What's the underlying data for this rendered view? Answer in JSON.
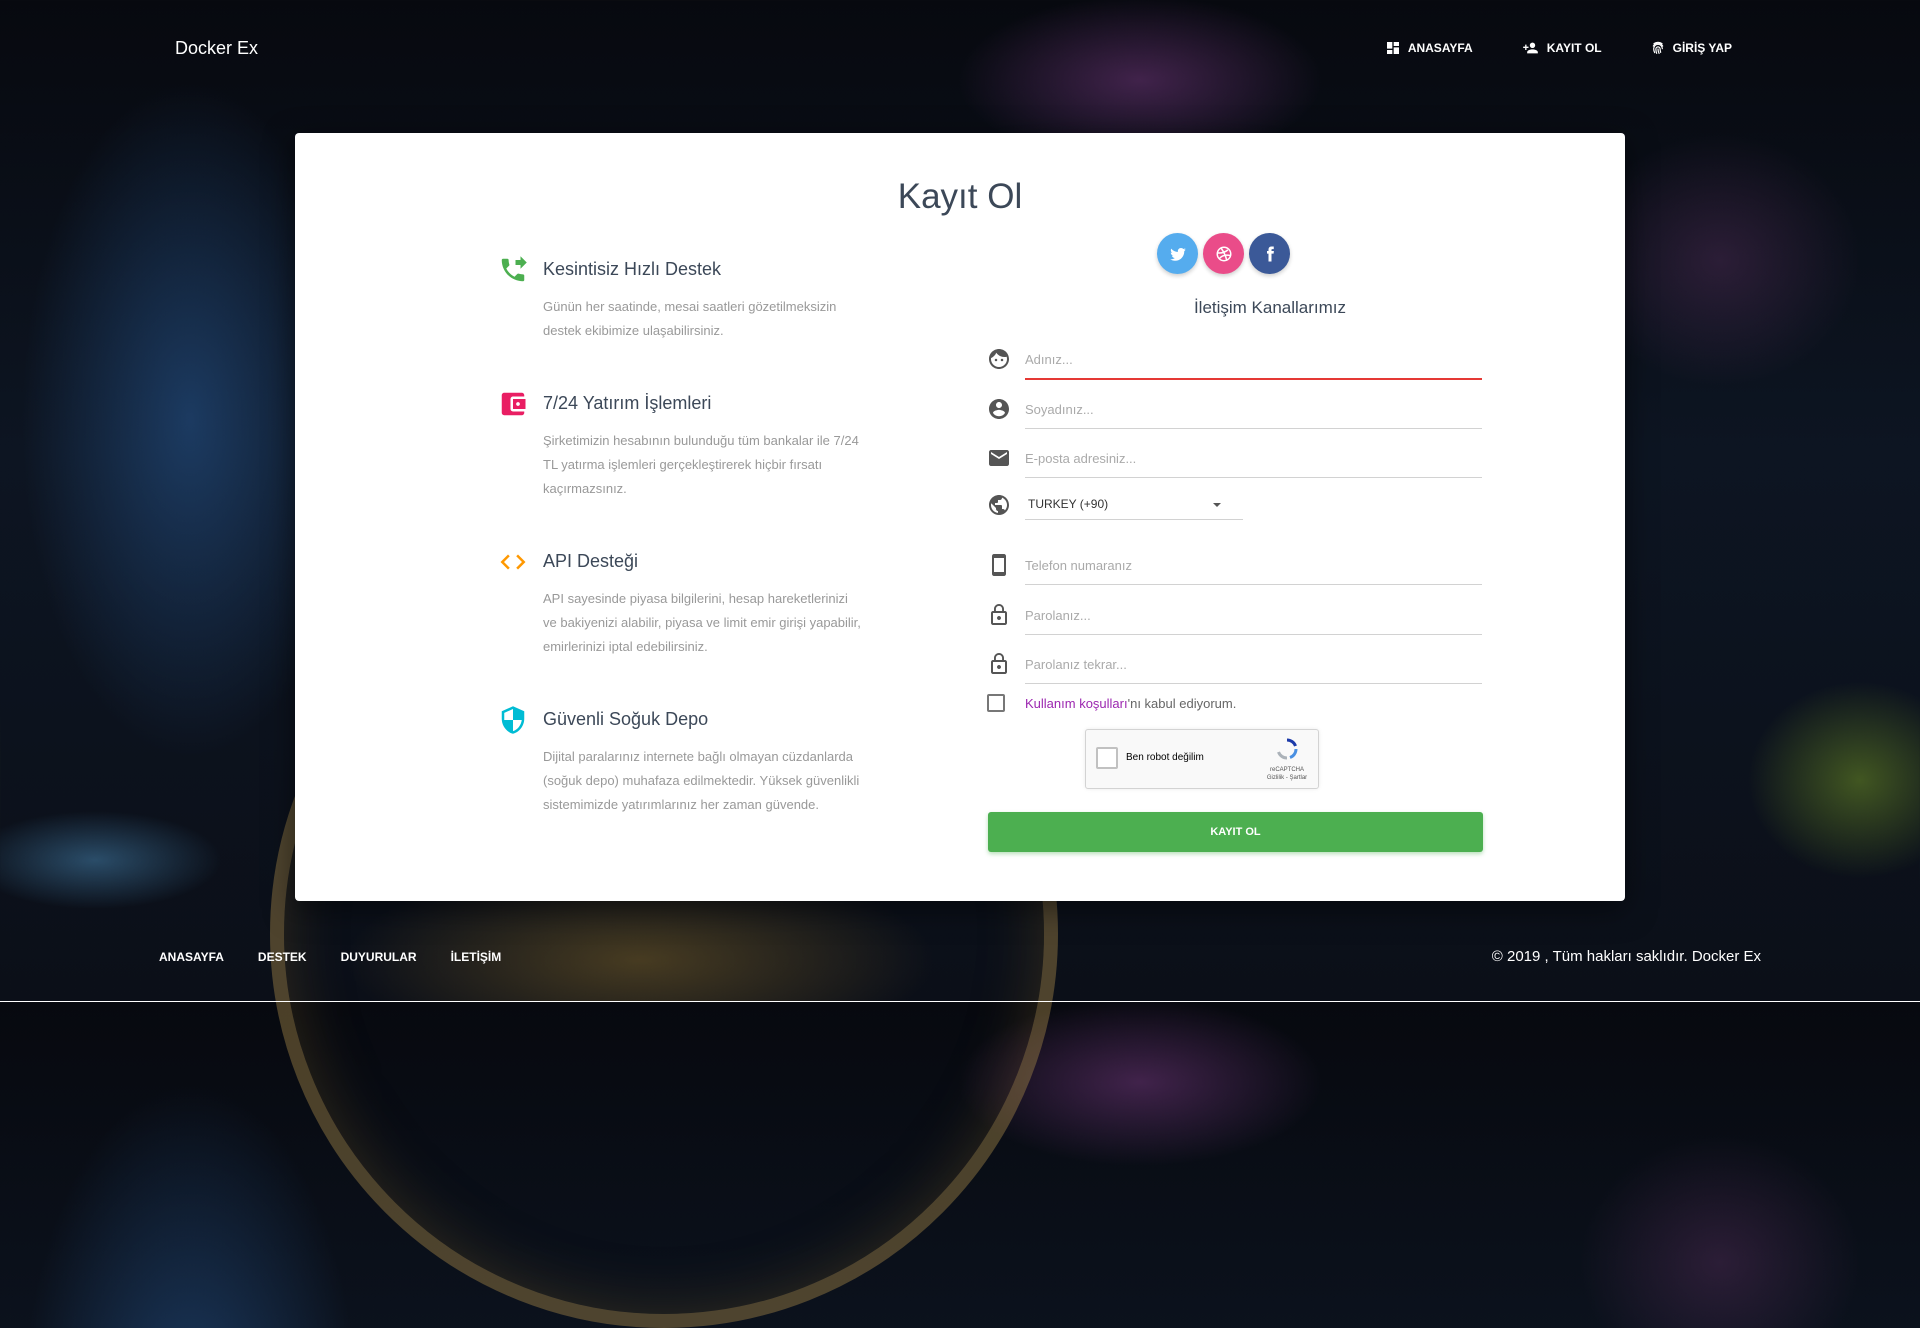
{
  "header": {
    "brand": "Docker Ex",
    "nav": [
      {
        "label": "ANASAYFA",
        "icon": "dashboard-icon"
      },
      {
        "label": "KAYIT OL",
        "icon": "person-add-icon"
      },
      {
        "label": "GİRİŞ YAP",
        "icon": "fingerprint-icon"
      }
    ]
  },
  "card": {
    "title": "Kayıt Ol",
    "features": [
      {
        "icon": "phone-forward-icon",
        "color": "#4caf50",
        "title": "Kesintisiz Hızlı Destek",
        "desc": "Günün her saatinde, mesai saatleri gözetilmeksizin destek ekibimize ulaşabilirsiniz."
      },
      {
        "icon": "wallet-icon",
        "color": "#e91e63",
        "title": "7/24 Yatırım İşlemleri",
        "desc": "Şirketimizin hesabının bulunduğu tüm bankalar ile 7/24 TL yatırma işlemleri gerçekleştirerek hiçbir fırsatı kaçırmazsınız."
      },
      {
        "icon": "code-icon",
        "color": "#ff9800",
        "title": "API Desteği",
        "desc": "API sayesinde piyasa bilgilerini, hesap hareketlerinizi ve bakiyenizi alabilir, piyasa ve limit emir girişi yapabilir, emirlerinizi iptal edebilirsiniz."
      },
      {
        "icon": "shield-icon",
        "color": "#00bcd4",
        "title": "Güvenli Soğuk Depo",
        "desc": "Dijital paralarınız internete bağlı olmayan cüzdanlarda (soğuk depo) muhafaza edilmektedir. Yüksek güvenlikli sistemimizde yatırımlarınız her zaman güvende."
      }
    ],
    "social": [
      {
        "name": "twitter-icon",
        "color": "#55acee"
      },
      {
        "name": "dribbble-icon",
        "color": "#ea4c89"
      },
      {
        "name": "facebook-icon",
        "color": "#3b5998"
      }
    ],
    "social_title": "İletişim Kanallarımız",
    "form": {
      "first_name_placeholder": "Adınız...",
      "last_name_placeholder": "Soyadınız...",
      "email_placeholder": "E-posta adresiniz...",
      "country_value": "TURKEY (+90)",
      "phone_placeholder": "Telefon numaranız",
      "password_placeholder": "Parolanız...",
      "password_repeat_placeholder": "Parolanız tekrar...",
      "terms_link": "Kullanım koşulları",
      "terms_rest": "'nı kabul ediyorum.",
      "captcha_text": "Ben robot değilim",
      "captcha_brand": "reCAPTCHA",
      "captcha_links": "Gizlilik - Şartlar",
      "submit_label": "KAYIT OL"
    }
  },
  "footer": {
    "links": [
      "ANASAYFA",
      "DESTEK",
      "DUYURULAR",
      "İLETİŞİM"
    ],
    "copyright": "© 2019 , Tüm hakları saklıdır. Docker Ex"
  }
}
